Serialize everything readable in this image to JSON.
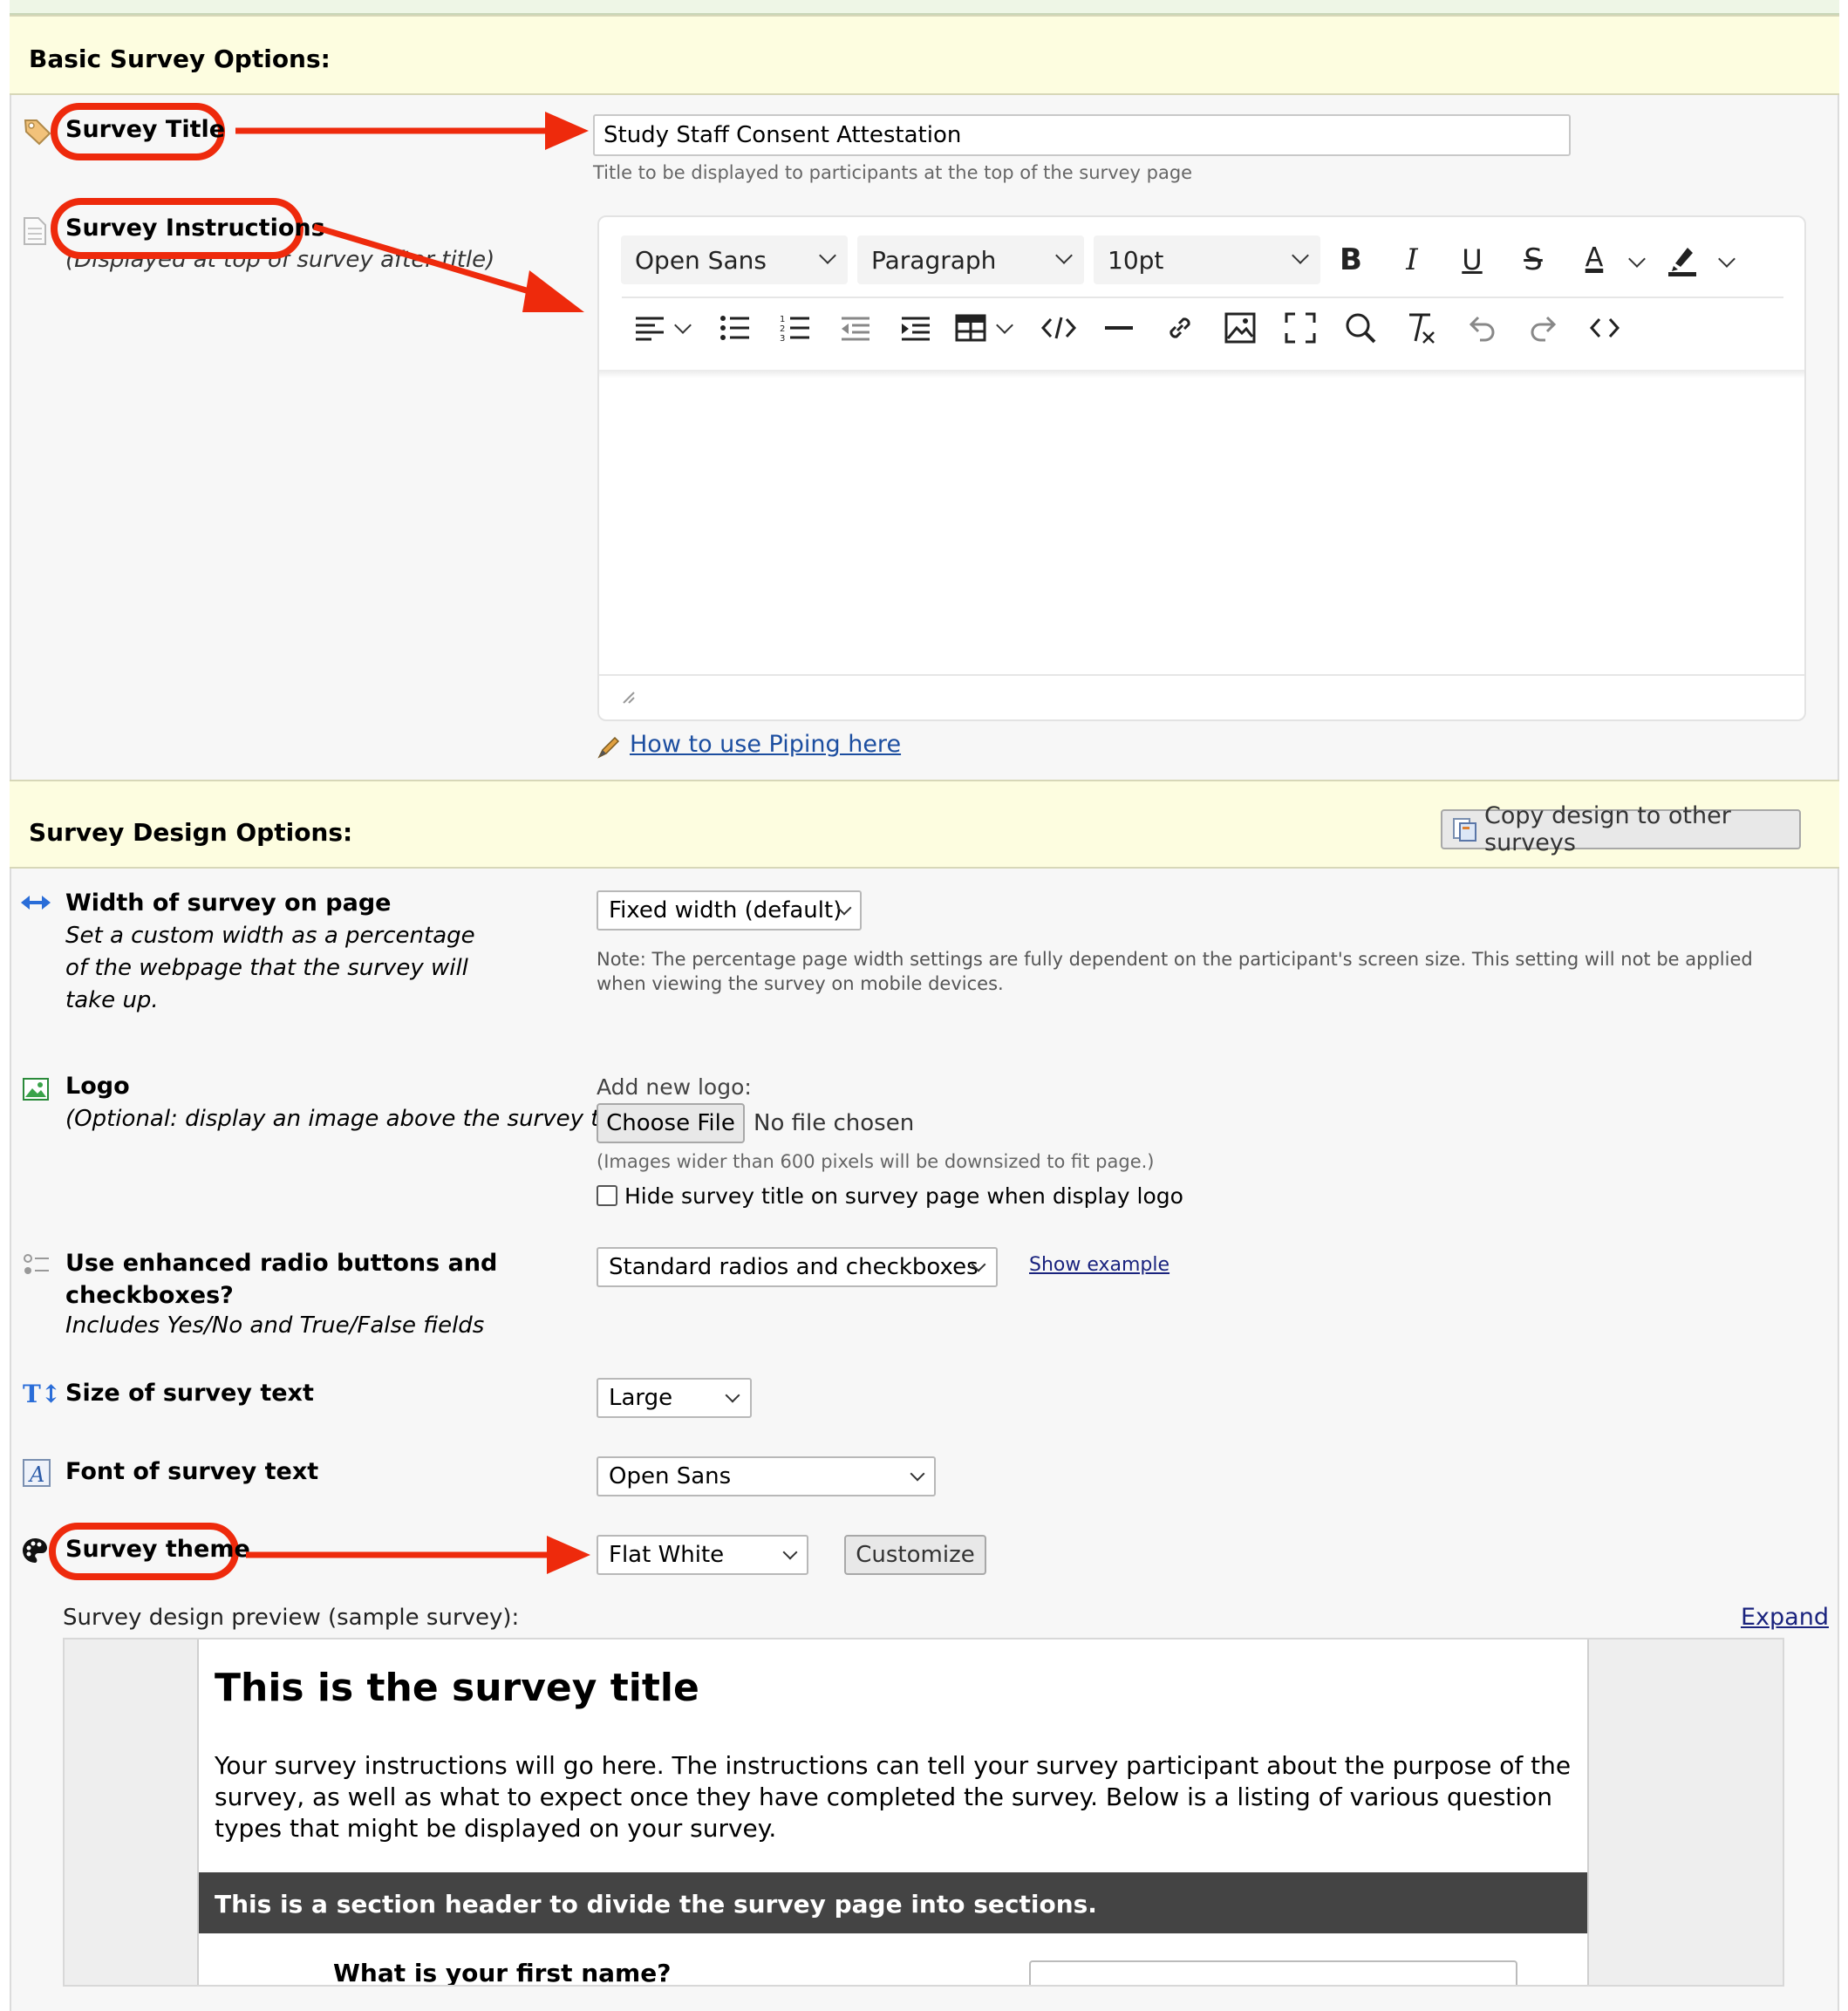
{
  "basic": {
    "header": "Basic Survey Options:",
    "survey_title_label": "Survey Title",
    "survey_title_value": "Study Staff Consent Attestation",
    "survey_title_hint": "Title to be displayed to participants at the top of the survey page",
    "instructions_label": "Survey Instructions",
    "instructions_sub": "(Displayed at top of survey after title)",
    "toolbar": {
      "font": "Open Sans",
      "block": "Paragraph",
      "size": "10pt",
      "bold": "B",
      "italic": "I",
      "underline": "U",
      "strike": "S",
      "text_color": "A"
    },
    "piping_link": "How to use Piping here"
  },
  "design": {
    "header": "Survey Design Options:",
    "copy_button": "Copy design to other surveys",
    "width_label": "Width of survey on page",
    "width_sub": "Set a custom width as a percentage of the webpage that the survey will take up.",
    "width_select": "Fixed width (default)",
    "width_note": "Note: The percentage page width settings are fully dependent on the participant's screen size. This setting will not be applied when viewing the survey on mobile devices.",
    "logo_label": "Logo",
    "logo_sub": "(Optional: display an image above the survey title)",
    "logo_add": "Add new logo:",
    "choose_file": "Choose File",
    "no_file": "No file chosen",
    "logo_hint": "(Images wider than 600 pixels will be downsized to fit page.)",
    "hide_title": "Hide survey title on survey page when display logo",
    "enhanced_label": "Use enhanced radio buttons and checkboxes?",
    "enhanced_sub": "Includes Yes/No and True/False fields",
    "enhanced_select": "Standard radios and checkboxes",
    "show_example": "Show example",
    "size_label": "Size of survey text",
    "size_select": "Large",
    "font_label": "Font of survey text",
    "font_select": "Open Sans",
    "theme_label": "Survey theme",
    "theme_select": "Flat White",
    "customize": "Customize",
    "preview_label": "Survey design preview (sample survey):",
    "expand": "Expand"
  },
  "preview": {
    "title": "This is the survey title",
    "instructions": "Your survey instructions will go here. The instructions can tell your survey participant about the purpose of the survey, as well as what to expect once they have completed the survey. Below is a listing of various question types that might be displayed on your survey.",
    "section_header": "This is a section header to divide the survey page into sections.",
    "question1": "What is your first name?"
  },
  "colors": {
    "header_bg": "#fdfde0",
    "annotation": "#ee2a0c",
    "link": "#1c4ea0",
    "section_bar": "#444444"
  },
  "icons": [
    "tag-icon",
    "document-icon",
    "arrows-horizontal-icon",
    "image-icon",
    "radio-list-icon",
    "text-size-icon",
    "font-icon",
    "palette-icon",
    "pencil-icon",
    "copy-icon"
  ]
}
